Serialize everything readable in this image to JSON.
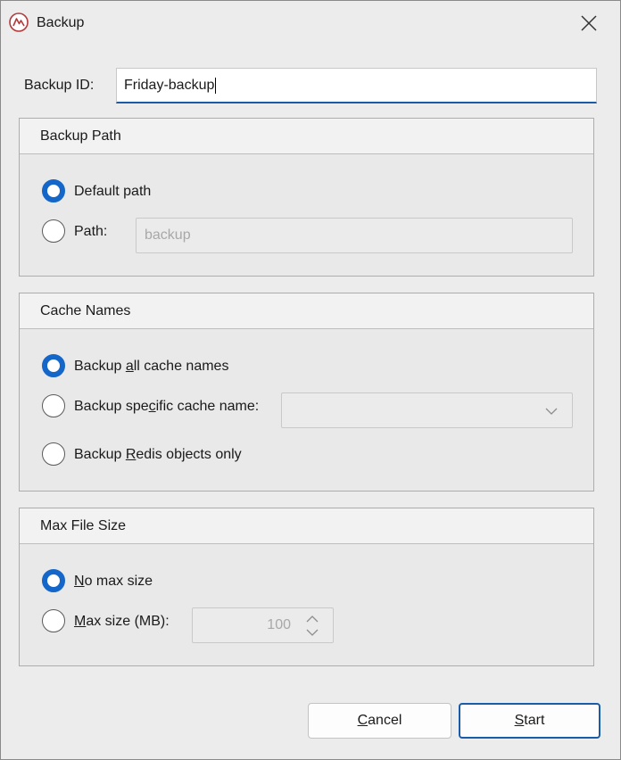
{
  "window": {
    "title": "Backup"
  },
  "backup_id": {
    "label": "Backup ID:",
    "value": "Friday-backup"
  },
  "backup_path": {
    "header": "Backup Path",
    "default_label": "Default path",
    "path_label": "Path:",
    "path_placeholder": "backup",
    "selected": "default"
  },
  "cache_names": {
    "header": "Cache Names",
    "all_label_pre": "Backup ",
    "all_label_key": "a",
    "all_label_post": "ll cache names",
    "specific_label_pre": "Backup spe",
    "specific_label_key": "c",
    "specific_label_post": "ific cache name:",
    "redis_label_pre": "Backup ",
    "redis_label_key": "R",
    "redis_label_post": "edis objects only",
    "selected": "all"
  },
  "max_file_size": {
    "header": "Max File Size",
    "none_label_key": "N",
    "none_label_post": "o max size",
    "max_label_key": "M",
    "max_label_post": "ax size (MB):",
    "max_value": "100",
    "selected": "none"
  },
  "buttons": {
    "cancel_key": "C",
    "cancel_post": "ancel",
    "start_key": "S",
    "start_post": "tart"
  },
  "colors": {
    "accent": "#1466c8",
    "focus_border": "#1a5ca8"
  }
}
